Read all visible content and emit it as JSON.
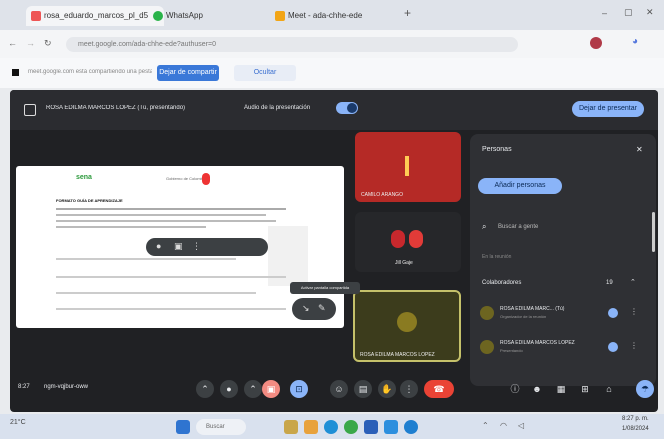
{
  "tabs": [
    {
      "label": "rosa_eduardo_marcos_pl_d5",
      "color": "#e55"
    },
    {
      "label": "WhatsApp",
      "color": "#2ab34a"
    },
    {
      "label": "Meet - ada-chhe-ede",
      "color": "#f2a516"
    }
  ],
  "address": {
    "url": "meet.google.com/ada-chhe-ede?authuser=0"
  },
  "infobar": {
    "text": "meet.google.com está compartiendo una pestaña con meet.google.com",
    "share_button": "Dejar de compartir",
    "hide_button": "Ocultar"
  },
  "meet": {
    "presenter_label": "ROSA EDILMA MARCOS LOPEZ (Tú, presentando)",
    "audio_label": "Audio de la presentación",
    "stop_presenting": "Dejar de presentar",
    "tiles": [
      {
        "name": "CAMILO ARANGO"
      },
      {
        "name": "Jill Gaje"
      },
      {
        "name": "ROSA EDILMA MARCOS LOPEZ"
      }
    ],
    "tooltip": "Activar pantalla compartida",
    "time": "8:27",
    "meeting_code": "ngm-vqjbur-oww",
    "people": {
      "title": "Personas",
      "add_button": "Añadir personas",
      "search_placeholder": "Buscar a gente",
      "section_label": "En la reunión",
      "group_label": "Colaboradores",
      "group_count": "19",
      "rows": [
        {
          "name": "ROSA EDILMA MARC... (Tú)",
          "sub": "Organizador de la reunión"
        },
        {
          "name": "ROSA EDILMA MARCOS LOPEZ",
          "sub": "Presentando"
        }
      ]
    },
    "doc": {
      "logo_text": "sena",
      "org_text": "Gobierno de Colombia",
      "title": "FORMATO GUÍA DE APRENDIZAJE"
    }
  },
  "taskbar": {
    "weather": "21°C",
    "search": "Buscar",
    "time": "8:27 p. m.",
    "date": "1/08/2024"
  },
  "colors": {
    "accent": "#8ab4f8",
    "end_call": "#ea4335",
    "meet_bg": "#202124"
  }
}
